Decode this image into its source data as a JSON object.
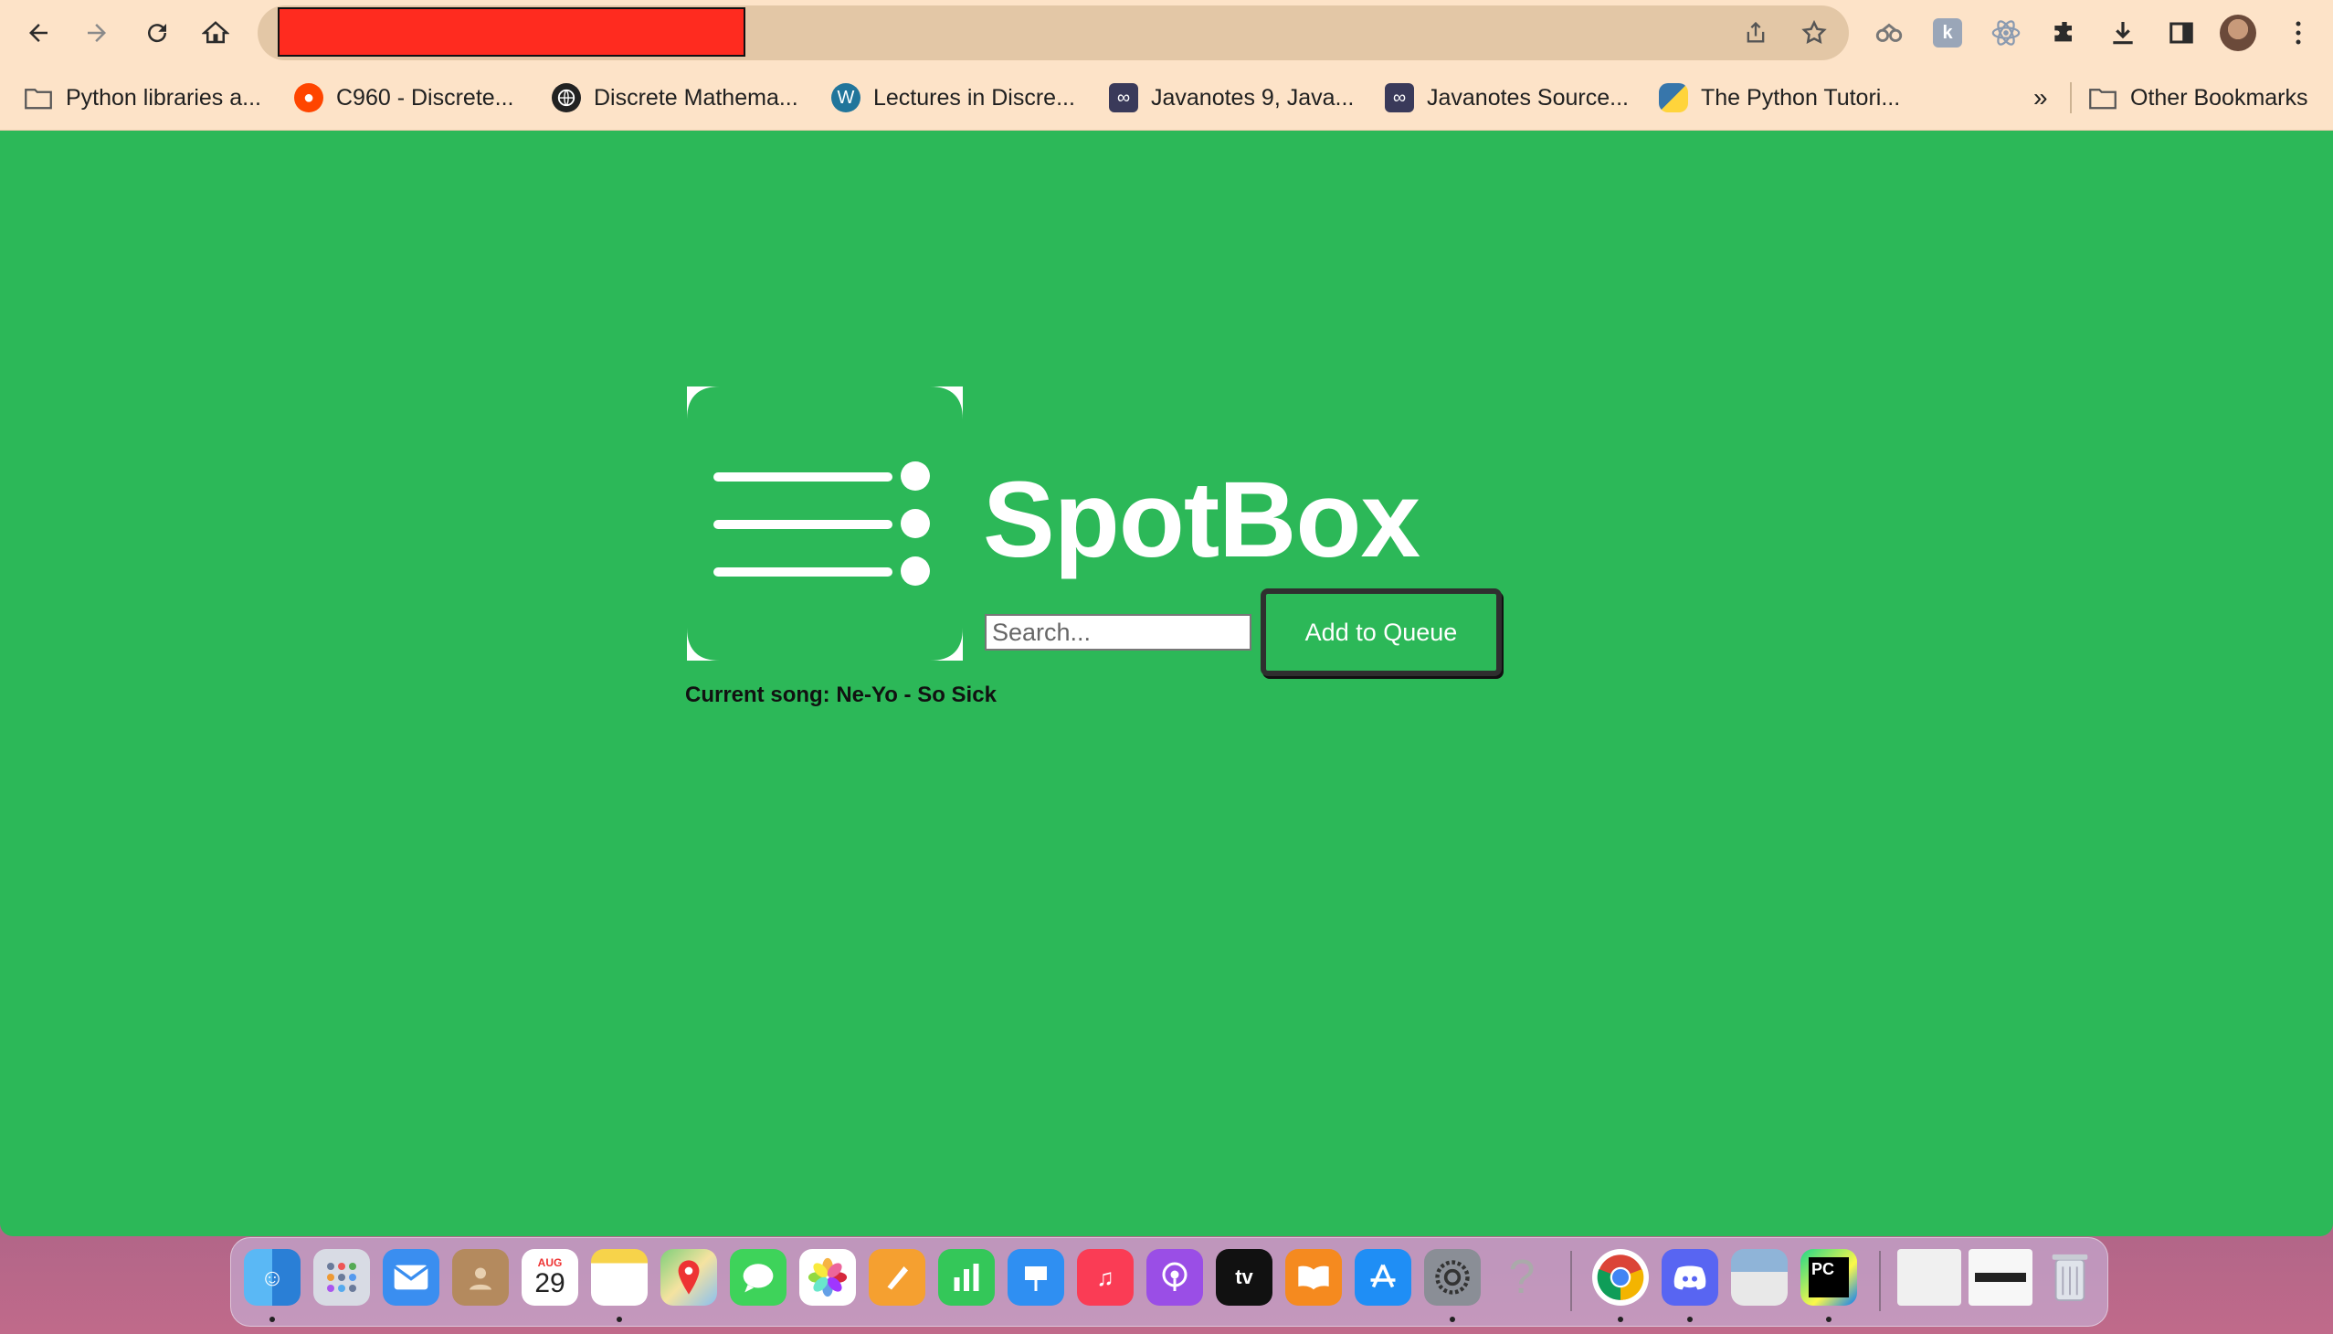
{
  "browser": {
    "bookmarks": [
      {
        "label": "Python libraries a...",
        "icon": "folder-icon"
      },
      {
        "label": "C960 - Discrete...",
        "icon": "reddit-icon"
      },
      {
        "label": "Discrete Mathema...",
        "icon": "globe-icon"
      },
      {
        "label": "Lectures in Discre...",
        "icon": "wordpress-icon"
      },
      {
        "label": "Javanotes 9, Java...",
        "icon": "javanotes-icon"
      },
      {
        "label": "Javanotes Source...",
        "icon": "javanotes-icon"
      },
      {
        "label": "The Python Tutori...",
        "icon": "python-icon"
      }
    ],
    "more_bookmarks": "»",
    "other_bookmarks": "Other Bookmarks"
  },
  "app": {
    "title": "SpotBox",
    "search_placeholder": "Search...",
    "add_button": "Add to Queue",
    "current_song": "Current song: Ne-Yo - So Sick"
  },
  "dock": {
    "calendar_month": "AUG",
    "calendar_day": "29",
    "apps": [
      "finder",
      "launchpad",
      "mail",
      "contacts",
      "calendar",
      "notes",
      "maps",
      "messages",
      "photos",
      "pages",
      "numbers",
      "keynote",
      "music",
      "podcasts",
      "tv",
      "books",
      "app-store",
      "system-settings",
      "help",
      "chrome",
      "discord",
      "preview",
      "pycharm",
      "window-1",
      "window-2",
      "trash"
    ]
  },
  "colors": {
    "page_bg": "#2cb858",
    "chrome_bg": "#fde3c8",
    "redaction": "#ff2b1f"
  }
}
